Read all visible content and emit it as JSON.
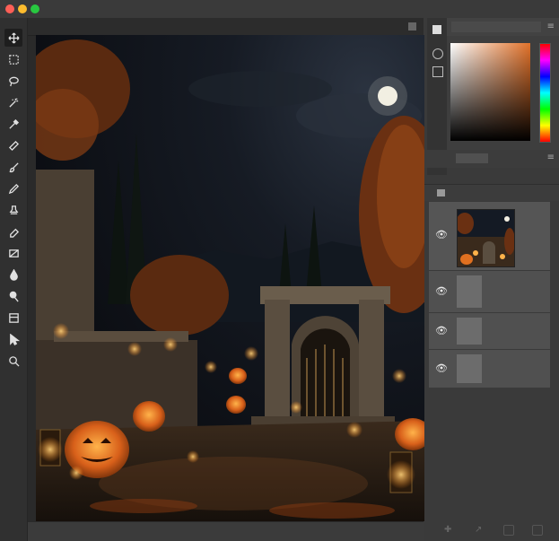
{
  "window": {
    "controls": [
      "close",
      "minimize",
      "zoom"
    ],
    "colors": {
      "close": "#fe5f57",
      "minimize": "#febc2e",
      "zoom": "#28c840"
    }
  },
  "toolbar": {
    "tools": [
      {
        "name": "move-tool",
        "icon": "move-icon"
      },
      {
        "name": "marquee-tool",
        "icon": "marquee-icon"
      },
      {
        "name": "lasso-tool",
        "icon": "lasso-icon"
      },
      {
        "name": "magic-wand-tool",
        "icon": "magic-wand-icon"
      },
      {
        "name": "eyedropper-tool",
        "icon": "eyedropper-icon"
      },
      {
        "name": "healing-tool",
        "icon": "healing-brush-icon"
      },
      {
        "name": "brush-tool",
        "icon": "brush-icon"
      },
      {
        "name": "pencil-tool",
        "icon": "pencil-icon"
      },
      {
        "name": "stamp-tool",
        "icon": "stamp-icon"
      },
      {
        "name": "eraser-tool",
        "icon": "eraser-icon"
      },
      {
        "name": "gradient-tool",
        "icon": "gradient-icon"
      },
      {
        "name": "blur-tool",
        "icon": "blur-drop-icon"
      },
      {
        "name": "dodge-tool",
        "icon": "dodge-icon"
      },
      {
        "name": "crop-tool",
        "icon": "crop-icon"
      },
      {
        "name": "select-tool",
        "icon": "arrow-pointer-icon"
      },
      {
        "name": "zoom-tool",
        "icon": "zoom-icon"
      }
    ]
  },
  "color_panel": {
    "base_hue": "#e2722a",
    "hue_strip": "rainbow"
  },
  "layers": {
    "rows": [
      {
        "name": "layer-image",
        "visible": true,
        "selected": true
      },
      {
        "name": "layer-2",
        "visible": true,
        "selected": false
      },
      {
        "name": "layer-3",
        "visible": true,
        "selected": false
      },
      {
        "name": "layer-4",
        "visible": true,
        "selected": false
      }
    ]
  },
  "canvas": {
    "scene": "halloween-courtyard-night",
    "accent": "#f08a2a"
  }
}
